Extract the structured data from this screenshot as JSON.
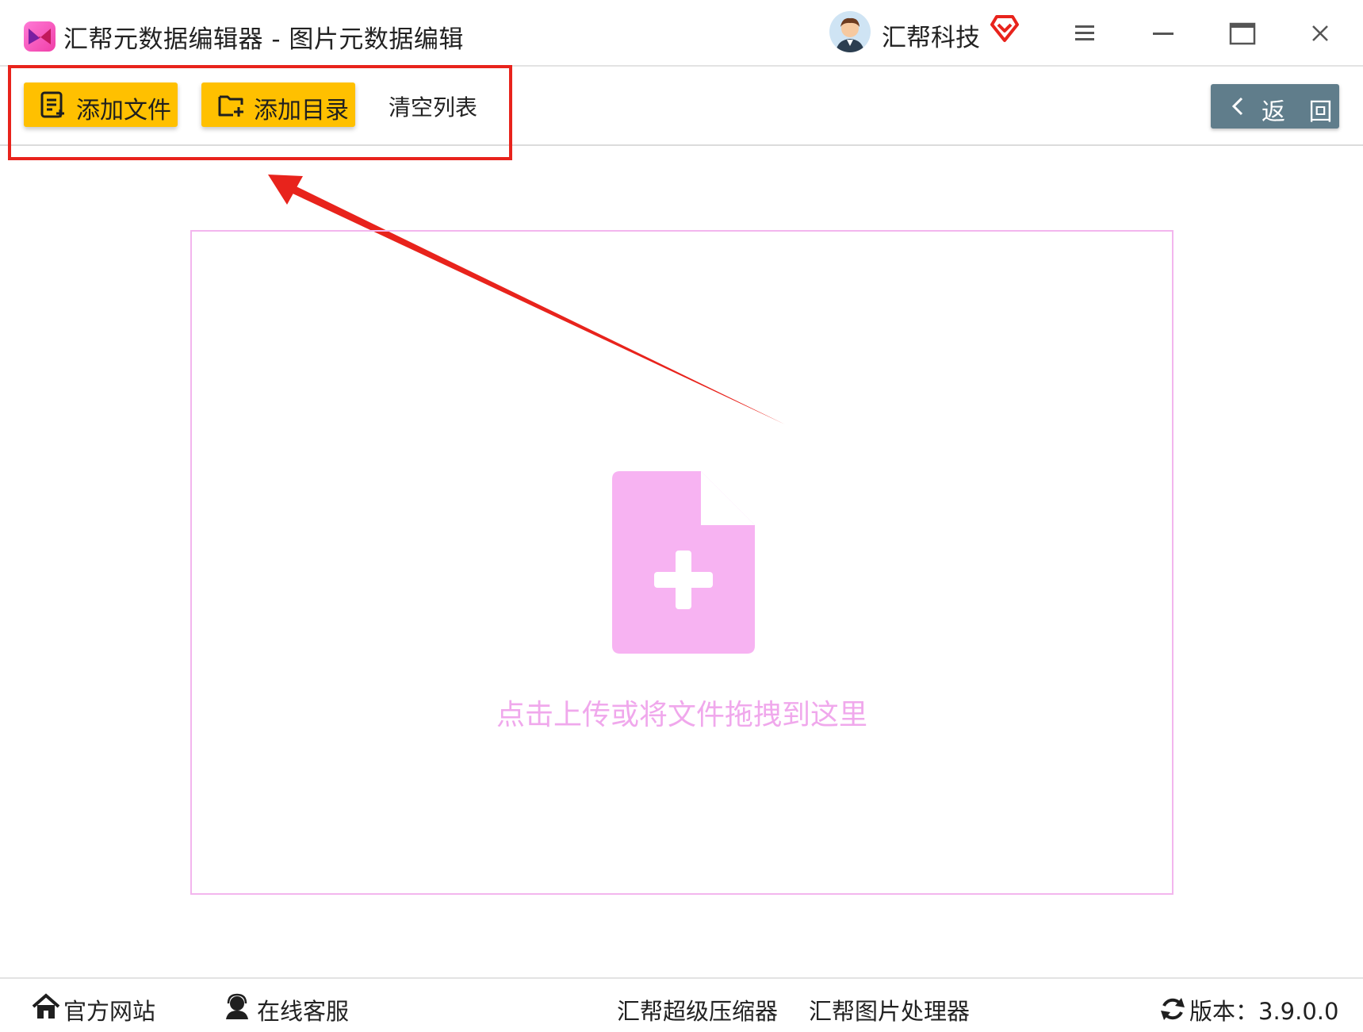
{
  "window": {
    "title": "汇帮元数据编辑器 - 图片元数据编辑",
    "user_name": "汇帮科技",
    "controls": [
      "menu-icon",
      "minimize-icon",
      "maximize-icon",
      "close-icon"
    ]
  },
  "toolbar": {
    "add_file_label": "添加文件",
    "add_folder_label": "添加目录",
    "clear_list_label": "清空列表",
    "back_label": "返 回"
  },
  "dropzone": {
    "hint": "点击上传或将文件拖拽到这里",
    "icon": "file-add-icon"
  },
  "footer": {
    "website_label": "官方网站",
    "support_label": "在线客服",
    "compressor_link": "汇帮超级压缩器",
    "image_tool_link": "汇帮图片处理器",
    "version_text": "版本：3.9.0.0"
  },
  "colors": {
    "accent_yellow": "#ffc000",
    "back_button": "#607d8b",
    "highlight_red": "#e8231c",
    "drop_pink": "#f7b3f2",
    "drop_border": "#f3b6ee"
  }
}
